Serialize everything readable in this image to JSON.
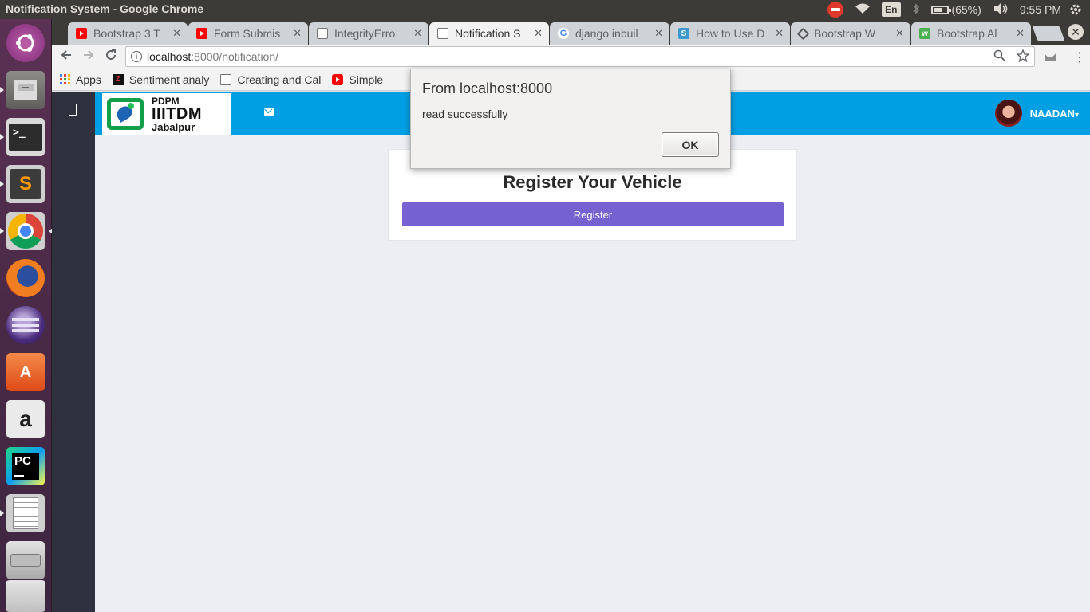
{
  "system": {
    "window_title": "Notification System - Google Chrome",
    "lang": "En",
    "battery": "(65%)",
    "clock": "9:55 PM"
  },
  "tabs": [
    {
      "label": "Bootstrap 3 T",
      "icon": "youtube-icon",
      "active": false
    },
    {
      "label": "Form Submis",
      "icon": "youtube-icon",
      "active": false
    },
    {
      "label": "IntegrityErro",
      "icon": "document-icon",
      "active": false
    },
    {
      "label": "Notification S",
      "icon": "document-icon",
      "active": true
    },
    {
      "label": "django inbuil",
      "icon": "google-icon",
      "active": false
    },
    {
      "label": "How to Use D",
      "icon": "s-icon",
      "active": false
    },
    {
      "label": "Bootstrap W",
      "icon": "bootstrap-icon",
      "active": false
    },
    {
      "label": "Bootstrap Al",
      "icon": "w3-icon",
      "active": false
    }
  ],
  "toolbar": {
    "url_host": "localhost",
    "url_rest": ":8000/notification/"
  },
  "bookmarks": [
    {
      "label": "Apps",
      "icon": "apps-grid-icon"
    },
    {
      "label": "Sentiment analy",
      "icon": "z-icon"
    },
    {
      "label": "Creating and Cal",
      "icon": "document-icon"
    },
    {
      "label": "Simple",
      "icon": "youtube-icon"
    }
  ],
  "header": {
    "logo_line1": "PDPM",
    "logo_line2": "IIITDM",
    "logo_line3": "Jabalpur",
    "user_name": "NAADAN",
    "caret": "▾"
  },
  "card": {
    "title": "Register Your Vehicle",
    "button_label": "Register"
  },
  "alert": {
    "title": "From localhost:8000",
    "message": "read successfully",
    "ok_label": "OK"
  },
  "colors": {
    "header_blue": "#009fe3",
    "button_purple": "#7661d1",
    "sidebar_dark": "#2f323e"
  }
}
